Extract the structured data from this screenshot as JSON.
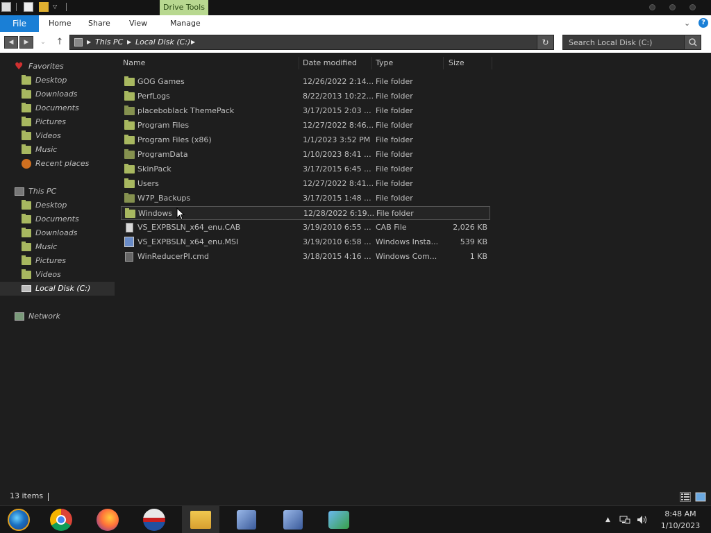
{
  "titlebar": {
    "drive_tools_label": "Drive Tools"
  },
  "ribbon": {
    "tabs": [
      {
        "label": "File"
      },
      {
        "label": "Home"
      },
      {
        "label": "Share"
      },
      {
        "label": "View"
      },
      {
        "label": "Manage"
      }
    ],
    "help_label": "?"
  },
  "address": {
    "crumbs": [
      "This PC",
      "Local Disk (C:)"
    ],
    "search_placeholder": "Search Local Disk (C:)"
  },
  "navpane": {
    "favorites_label": "Favorites",
    "favorites": [
      "Desktop",
      "Downloads",
      "Documents",
      "Pictures",
      "Videos",
      "Music",
      "Recent places"
    ],
    "thispc_label": "This PC",
    "thispc": [
      "Desktop",
      "Documents",
      "Downloads",
      "Music",
      "Pictures",
      "Videos",
      "Local Disk (C:)"
    ],
    "network_label": "Network"
  },
  "columns": {
    "name": "Name",
    "date": "Date modified",
    "type": "Type",
    "size": "Size"
  },
  "files": [
    {
      "name": "GOG Games",
      "date": "12/26/2022 2:14...",
      "type": "File folder",
      "size": "",
      "icon": "folder-icon"
    },
    {
      "name": "PerfLogs",
      "date": "8/22/2013 10:22...",
      "type": "File folder",
      "size": "",
      "icon": "folder-icon"
    },
    {
      "name": "placeboblack ThemePack",
      "date": "3/17/2015 2:03 ...",
      "type": "File folder",
      "size": "",
      "icon": "folder-icon"
    },
    {
      "name": "Program Files",
      "date": "12/27/2022 8:46...",
      "type": "File folder",
      "size": "",
      "icon": "folder-icon"
    },
    {
      "name": "Program Files (x86)",
      "date": "1/1/2023 3:52 PM",
      "type": "File folder",
      "size": "",
      "icon": "folder-icon"
    },
    {
      "name": "ProgramData",
      "date": "1/10/2023 8:41 ...",
      "type": "File folder",
      "size": "",
      "icon": "folder-icon"
    },
    {
      "name": "SkinPack",
      "date": "3/17/2015 6:45 ...",
      "type": "File folder",
      "size": "",
      "icon": "folder-icon"
    },
    {
      "name": "Users",
      "date": "12/27/2022 8:41...",
      "type": "File folder",
      "size": "",
      "icon": "folder-icon"
    },
    {
      "name": "W7P_Backups",
      "date": "3/17/2015 1:48 ...",
      "type": "File folder",
      "size": "",
      "icon": "folder-icon"
    },
    {
      "name": "Windows",
      "date": "12/28/2022 6:19...",
      "type": "File folder",
      "size": "",
      "icon": "folder-icon"
    },
    {
      "name": "VS_EXPBSLN_x64_enu.CAB",
      "date": "3/19/2010 6:55 ...",
      "type": "CAB File",
      "size": "2,026 KB",
      "icon": "cab-file-icon"
    },
    {
      "name": "VS_EXPBSLN_x64_enu.MSI",
      "date": "3/19/2010 6:58 ...",
      "type": "Windows Insta...",
      "size": "539 KB",
      "icon": "msi-installer-icon"
    },
    {
      "name": "WinReducerPI.cmd",
      "date": "3/18/2015 4:16 ...",
      "type": "Windows Com...",
      "size": "1 KB",
      "icon": "cmd-script-icon"
    }
  ],
  "status": {
    "item_count": "13 items"
  },
  "tray": {
    "time": "8:48 AM",
    "date": "1/10/2023"
  },
  "colors": {
    "file_tab": "#1a7fd6",
    "drive_tools": "#b8d890",
    "folder": "#a8b860",
    "background": "#1e1e1e"
  }
}
